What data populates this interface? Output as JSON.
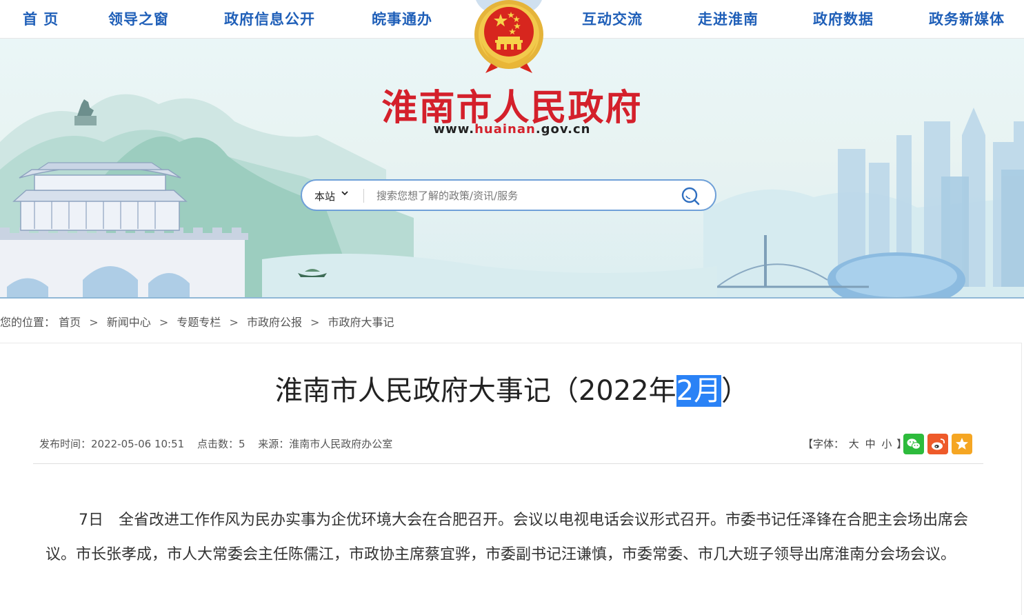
{
  "nav": {
    "items": [
      "首 页",
      "领导之窗",
      "政府信息公开",
      "皖事通办",
      "互动交流",
      "走进淮南",
      "政府数据",
      "政务新媒体"
    ]
  },
  "header": {
    "site_title": "淮南市人民政府",
    "url_prefix": "www.",
    "url_highlight": "huainan",
    "url_suffix": ".gov.cn"
  },
  "search": {
    "scope_label": "本站",
    "placeholder": "搜索您想了解的政策/资讯/服务"
  },
  "breadcrumb": {
    "prefix": "您的位置：",
    "items": [
      "首页",
      "新闻中心",
      "专题专栏",
      "市政府公报",
      "市政府大事记"
    ],
    "separator": ">"
  },
  "article": {
    "title_before": "淮南市人民政府大事记（2022年",
    "title_selected": "2月",
    "title_after": "）",
    "meta": {
      "publish_time": "发布时间：2022-05-06 10:51",
      "clicks": "点击数：5",
      "source": "来源：淮南市人民政府办公室"
    },
    "font_size": {
      "open": "【字体：",
      "large": "大",
      "medium": "中",
      "small": "小",
      "close": "】"
    },
    "share_icons": [
      "wechat-icon",
      "weibo-icon",
      "favorite-icon"
    ],
    "body": "7日　全省改进工作作风为民办实事为企优环境大会在合肥召开。会议以电视电话会议形式召开。市委书记任泽锋在合肥主会场出席会议。市长张孝成，市人大常委会主任陈儒江，市政协主席蔡宜骅，市委副书记汪谦慎，市委常委、市几大班子领导出席淮南分会场会议。"
  },
  "colors": {
    "nav_text": "#1f5fb8",
    "title_red": "#d4202b",
    "selection": "#2a82f6",
    "wechat": "#2dbb3c",
    "weibo": "#ee5a2a",
    "favorite": "#f5a623"
  }
}
